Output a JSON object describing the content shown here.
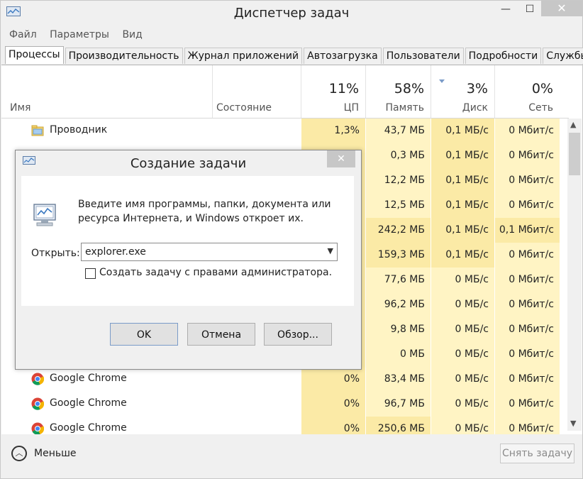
{
  "window": {
    "title": "Диспетчер задач",
    "close_glyph": "✕",
    "min_glyph": "—",
    "max_glyph": "☐"
  },
  "menu": [
    "Файл",
    "Параметры",
    "Вид"
  ],
  "tabs": [
    "Процессы",
    "Производительность",
    "Журнал приложений",
    "Автозагрузка",
    "Пользователи",
    "Подробности",
    "Службы"
  ],
  "header": {
    "name": "Имя",
    "status": "Состояние",
    "cpu": {
      "pct": "11%",
      "label": "ЦП"
    },
    "mem": {
      "pct": "58%",
      "label": "Память"
    },
    "disk": {
      "pct": "3%",
      "label": "Диск"
    },
    "net": {
      "pct": "0%",
      "label": "Сеть"
    }
  },
  "rows": [
    {
      "name": "Проводник",
      "icon": "explorer-folder-icon",
      "cpu": "1,3%",
      "mem": "43,7 МБ",
      "disk": "0,1 МБ/с",
      "net": "0 Мбит/с"
    },
    {
      "name": "",
      "icon": "",
      "cpu": "",
      "mem": "0,3 МБ",
      "disk": "0,1 МБ/с",
      "net": "0 Мбит/с"
    },
    {
      "name": "",
      "icon": "",
      "cpu": "",
      "mem": "12,2 МБ",
      "disk": "0,1 МБ/с",
      "net": "0 Мбит/с"
    },
    {
      "name": "",
      "icon": "",
      "cpu": "",
      "mem": "12,5 МБ",
      "disk": "0,1 МБ/с",
      "net": "0 Мбит/с"
    },
    {
      "name": "",
      "icon": "",
      "cpu": "",
      "mem": "242,2 МБ",
      "disk": "0,1 МБ/с",
      "net": "0,1 Мбит/с"
    },
    {
      "name": "",
      "icon": "",
      "cpu": "",
      "mem": "159,3 МБ",
      "disk": "0,1 МБ/с",
      "net": "0 Мбит/с"
    },
    {
      "name": "",
      "icon": "",
      "cpu": "",
      "mem": "77,6 МБ",
      "disk": "0 МБ/с",
      "net": "0 Мбит/с"
    },
    {
      "name": "",
      "icon": "",
      "cpu": "",
      "mem": "96,2 МБ",
      "disk": "0 МБ/с",
      "net": "0 Мбит/с"
    },
    {
      "name": "",
      "icon": "",
      "cpu": "",
      "mem": "9,8 МБ",
      "disk": "0 МБ/с",
      "net": "0 Мбит/с"
    },
    {
      "name": "",
      "icon": "",
      "cpu": "",
      "mem": "0 МБ",
      "disk": "0 МБ/с",
      "net": "0 Мбит/с"
    },
    {
      "name": "Google Chrome",
      "icon": "chrome-icon",
      "cpu": "0%",
      "mem": "83,4 МБ",
      "disk": "0 МБ/с",
      "net": "0 Мбит/с"
    },
    {
      "name": "Google Chrome",
      "icon": "chrome-icon",
      "cpu": "0%",
      "mem": "96,7 МБ",
      "disk": "0 МБ/с",
      "net": "0 Мбит/с"
    },
    {
      "name": "Google Chrome",
      "icon": "chrome-icon",
      "cpu": "0%",
      "mem": "250,6 МБ",
      "disk": "0 МБ/с",
      "net": "0 Мбит/с"
    }
  ],
  "footer": {
    "less_label": "Меньше",
    "end_task_label": "Снять задачу"
  },
  "dialog": {
    "title": "Создание задачи",
    "description": "Введите имя программы, папки, документа или ресурса Интернета, и Windows откроет их.",
    "open_label": "Открыть:",
    "open_value": "explorer.exe",
    "admin_checkbox_label": "Создать задачу с правами администратора.",
    "admin_checked": false,
    "ok_label": "OK",
    "cancel_label": "Отмена",
    "browse_label": "Обзор...",
    "close_glyph": "✕"
  },
  "colors": {
    "heat_light": "#fff4c4",
    "heat_medium": "#fbeaa6",
    "heat_strong": "#f8e08c",
    "accent": "#7a9bc8"
  }
}
